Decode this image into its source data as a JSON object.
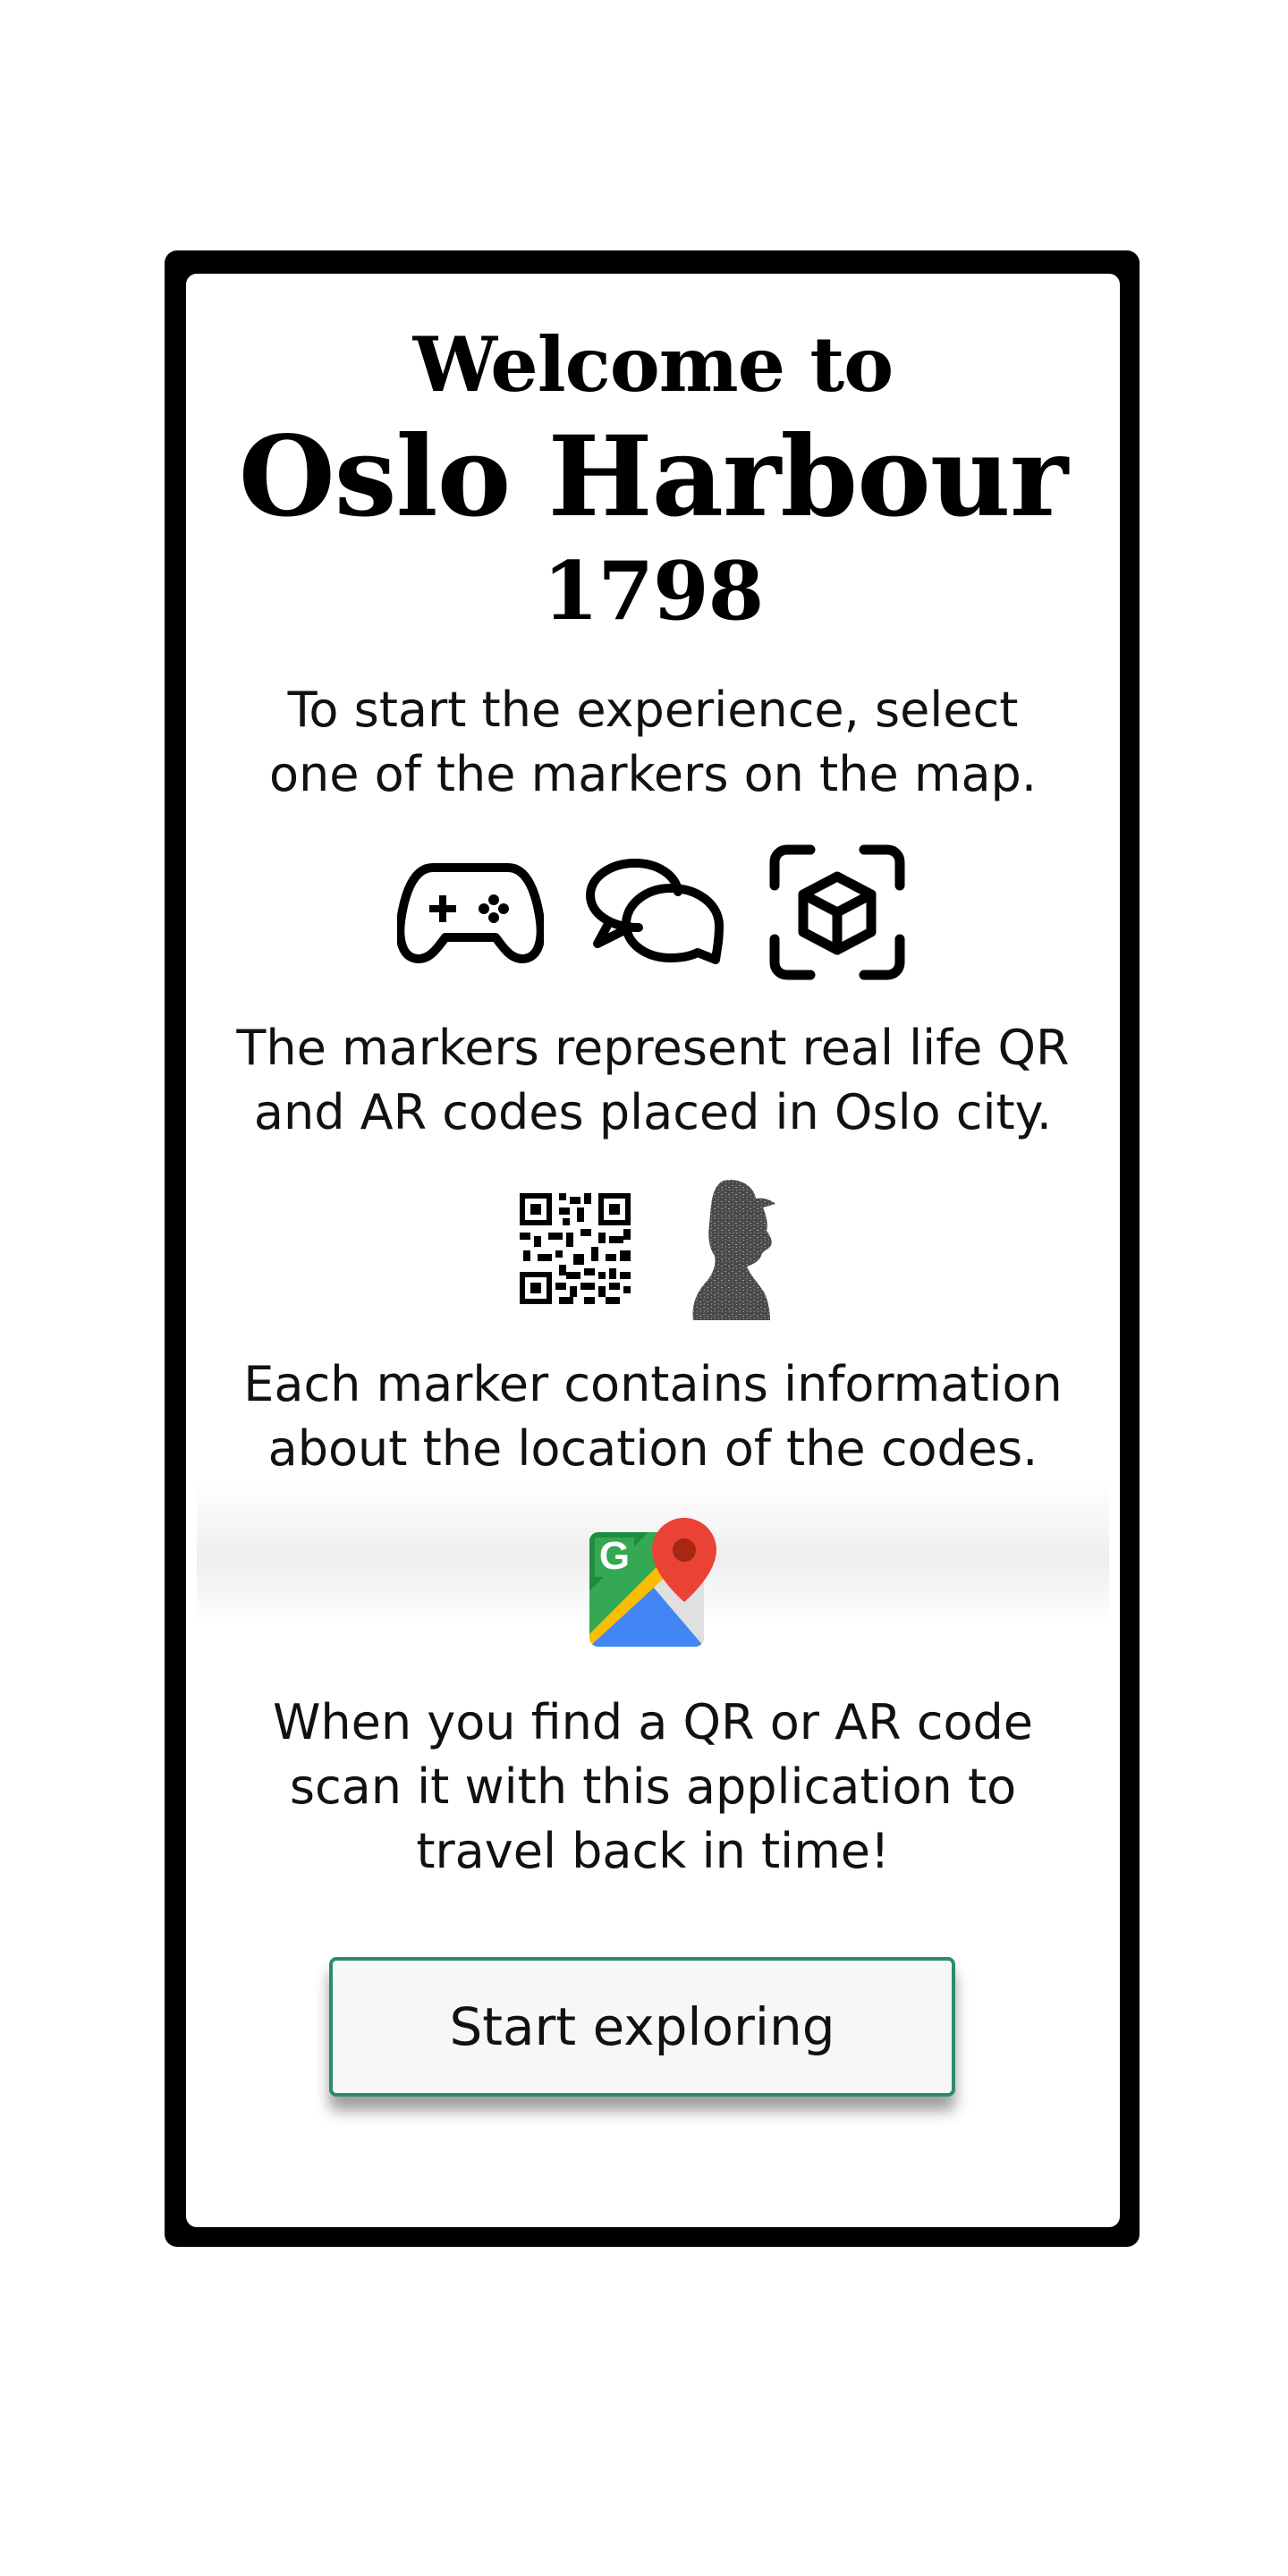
{
  "welcome": {
    "line1": "Welcome to",
    "line2": "Oslo Harbour",
    "year": "1798"
  },
  "instructions": {
    "p1_line1": "To start the experience, select",
    "p1_line2": "one of the markers on the map.",
    "p2_line1": "The markers represent real life QR",
    "p2_line2": "and AR codes placed in Oslo city.",
    "p3_line1": "Each marker contains information",
    "p3_line2": "about the location of the codes.",
    "p4_line1": "When you find a QR or AR code",
    "p4_line2": "scan it with this application to",
    "p4_line3": "travel back in time!"
  },
  "icons": {
    "row1": [
      "gamepad-icon",
      "chat-bubbles-icon",
      "ar-cube-icon"
    ],
    "row2": [
      "qr-code-icon",
      "ar-marker-silhouette-icon"
    ],
    "row3": [
      "google-maps-icon"
    ]
  },
  "button": {
    "label": "Start exploring",
    "border_color": "#2e8b68"
  }
}
